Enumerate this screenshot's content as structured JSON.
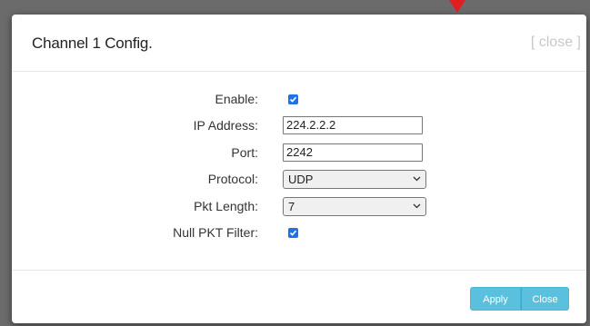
{
  "dialog": {
    "title": "Channel 1 Config.",
    "close_link": "[ close ]"
  },
  "form": {
    "enable": {
      "label": "Enable:",
      "checked": true
    },
    "ip_address": {
      "label": "IP Address:",
      "value": "224.2.2.2"
    },
    "port": {
      "label": "Port:",
      "value": "2242"
    },
    "protocol": {
      "label": "Protocol:",
      "value": "UDP"
    },
    "pkt_length": {
      "label": "Pkt Length:",
      "value": "7"
    },
    "null_pkt_filter": {
      "label": "Null PKT Filter:",
      "checked": true
    }
  },
  "footer": {
    "apply_label": "Apply",
    "close_label": "Close"
  },
  "colors": {
    "accent_button": "#5bc0de",
    "checkbox": "#1a73e8",
    "arrow": "#e02020"
  },
  "icons": [
    "arrow-pointer-icon",
    "checkmark-icon",
    "chevron-down-icon"
  ]
}
